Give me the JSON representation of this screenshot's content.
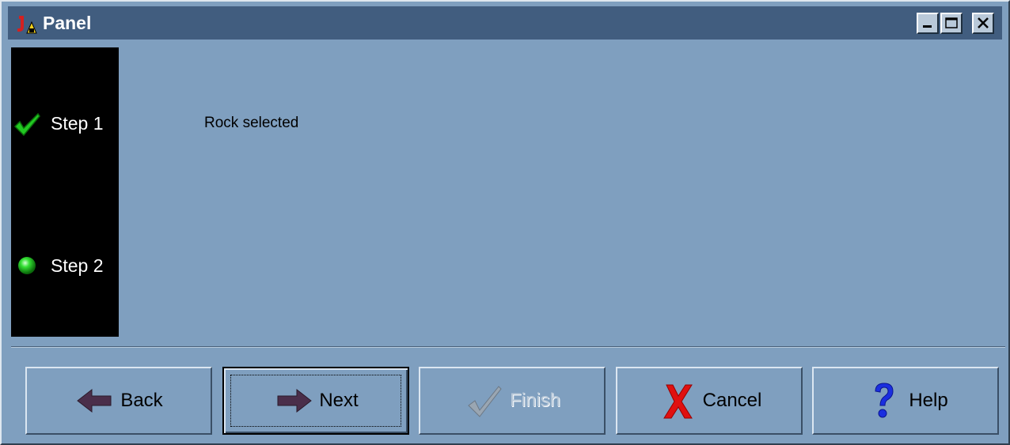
{
  "window": {
    "title": "Panel"
  },
  "title_icons": {
    "app": "java-app-icon",
    "minimize": "minimize-icon",
    "maximize": "maximize-icon",
    "close": "close-icon"
  },
  "steps": [
    {
      "label": "Step 1",
      "icon": "checkmark-icon",
      "state": "done"
    },
    {
      "label": "Step 2",
      "icon": "green-dot-icon",
      "state": "current"
    }
  ],
  "content": {
    "message": "Rock selected"
  },
  "buttons": {
    "back": {
      "label": "Back",
      "icon": "left-arrow-icon"
    },
    "next": {
      "label": "Next",
      "icon": "right-arrow-icon",
      "focused": true
    },
    "finish": {
      "label": "Finish",
      "icon": "checkmark-icon",
      "enabled": false
    },
    "cancel": {
      "label": "Cancel",
      "icon": "red-x-icon"
    },
    "help": {
      "label": "Help",
      "icon": "question-mark-icon"
    }
  },
  "colors": {
    "background": "#7f9fbf",
    "titlebar": "#415d7f",
    "step_panel": "#000000"
  }
}
